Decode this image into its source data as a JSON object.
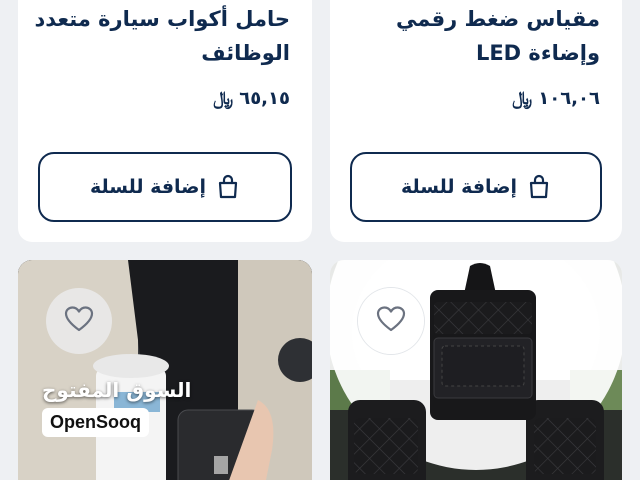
{
  "products": [
    {
      "title": "مقياس ضغط رقمي وإضاءة LED",
      "price": "١٠٦,٠٦",
      "currency_symbol": "﷼",
      "add_to_cart_label": "إضافة للسلة"
    },
    {
      "title": "حامل أكواب سيارة متعدد الوظائف",
      "price": "٦٥,١٥",
      "currency_symbol": "﷼",
      "add_to_cart_label": "إضافة للسلة"
    }
  ],
  "next_products": [
    {
      "image": "car-seat-organizer",
      "favorite_icon": "heart-icon"
    },
    {
      "image": "car-cup-holder",
      "favorite_icon": "heart-icon"
    }
  ],
  "watermark": {
    "arabic": "السوق المفتوح",
    "english": "OpenSooq"
  },
  "colors": {
    "primary": "#0f2a4f",
    "background": "#eef0f3",
    "card": "#ffffff"
  }
}
